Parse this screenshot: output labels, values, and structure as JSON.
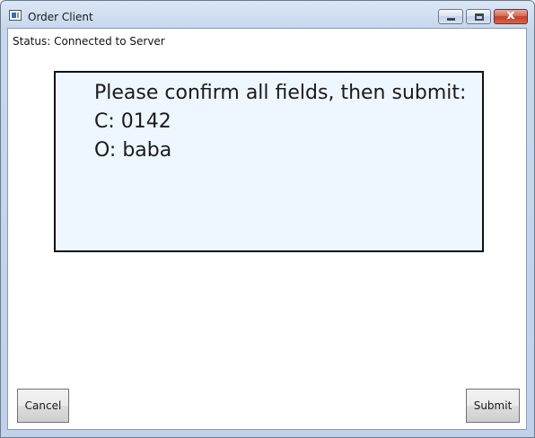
{
  "window": {
    "title": "Order Client"
  },
  "status": {
    "text": "Status: Connected to Server"
  },
  "confirmation": {
    "prompt": "Please confirm all fields, then submit:",
    "fields": [
      {
        "text": "C: 0142"
      },
      {
        "text": "O: baba"
      }
    ]
  },
  "buttons": {
    "cancel_label": "Cancel",
    "submit_label": "Submit"
  },
  "caption_buttons": {
    "close_glyph": "x"
  },
  "colors": {
    "confirm_background": "#eef6ff",
    "close_button": "#c3402a"
  }
}
